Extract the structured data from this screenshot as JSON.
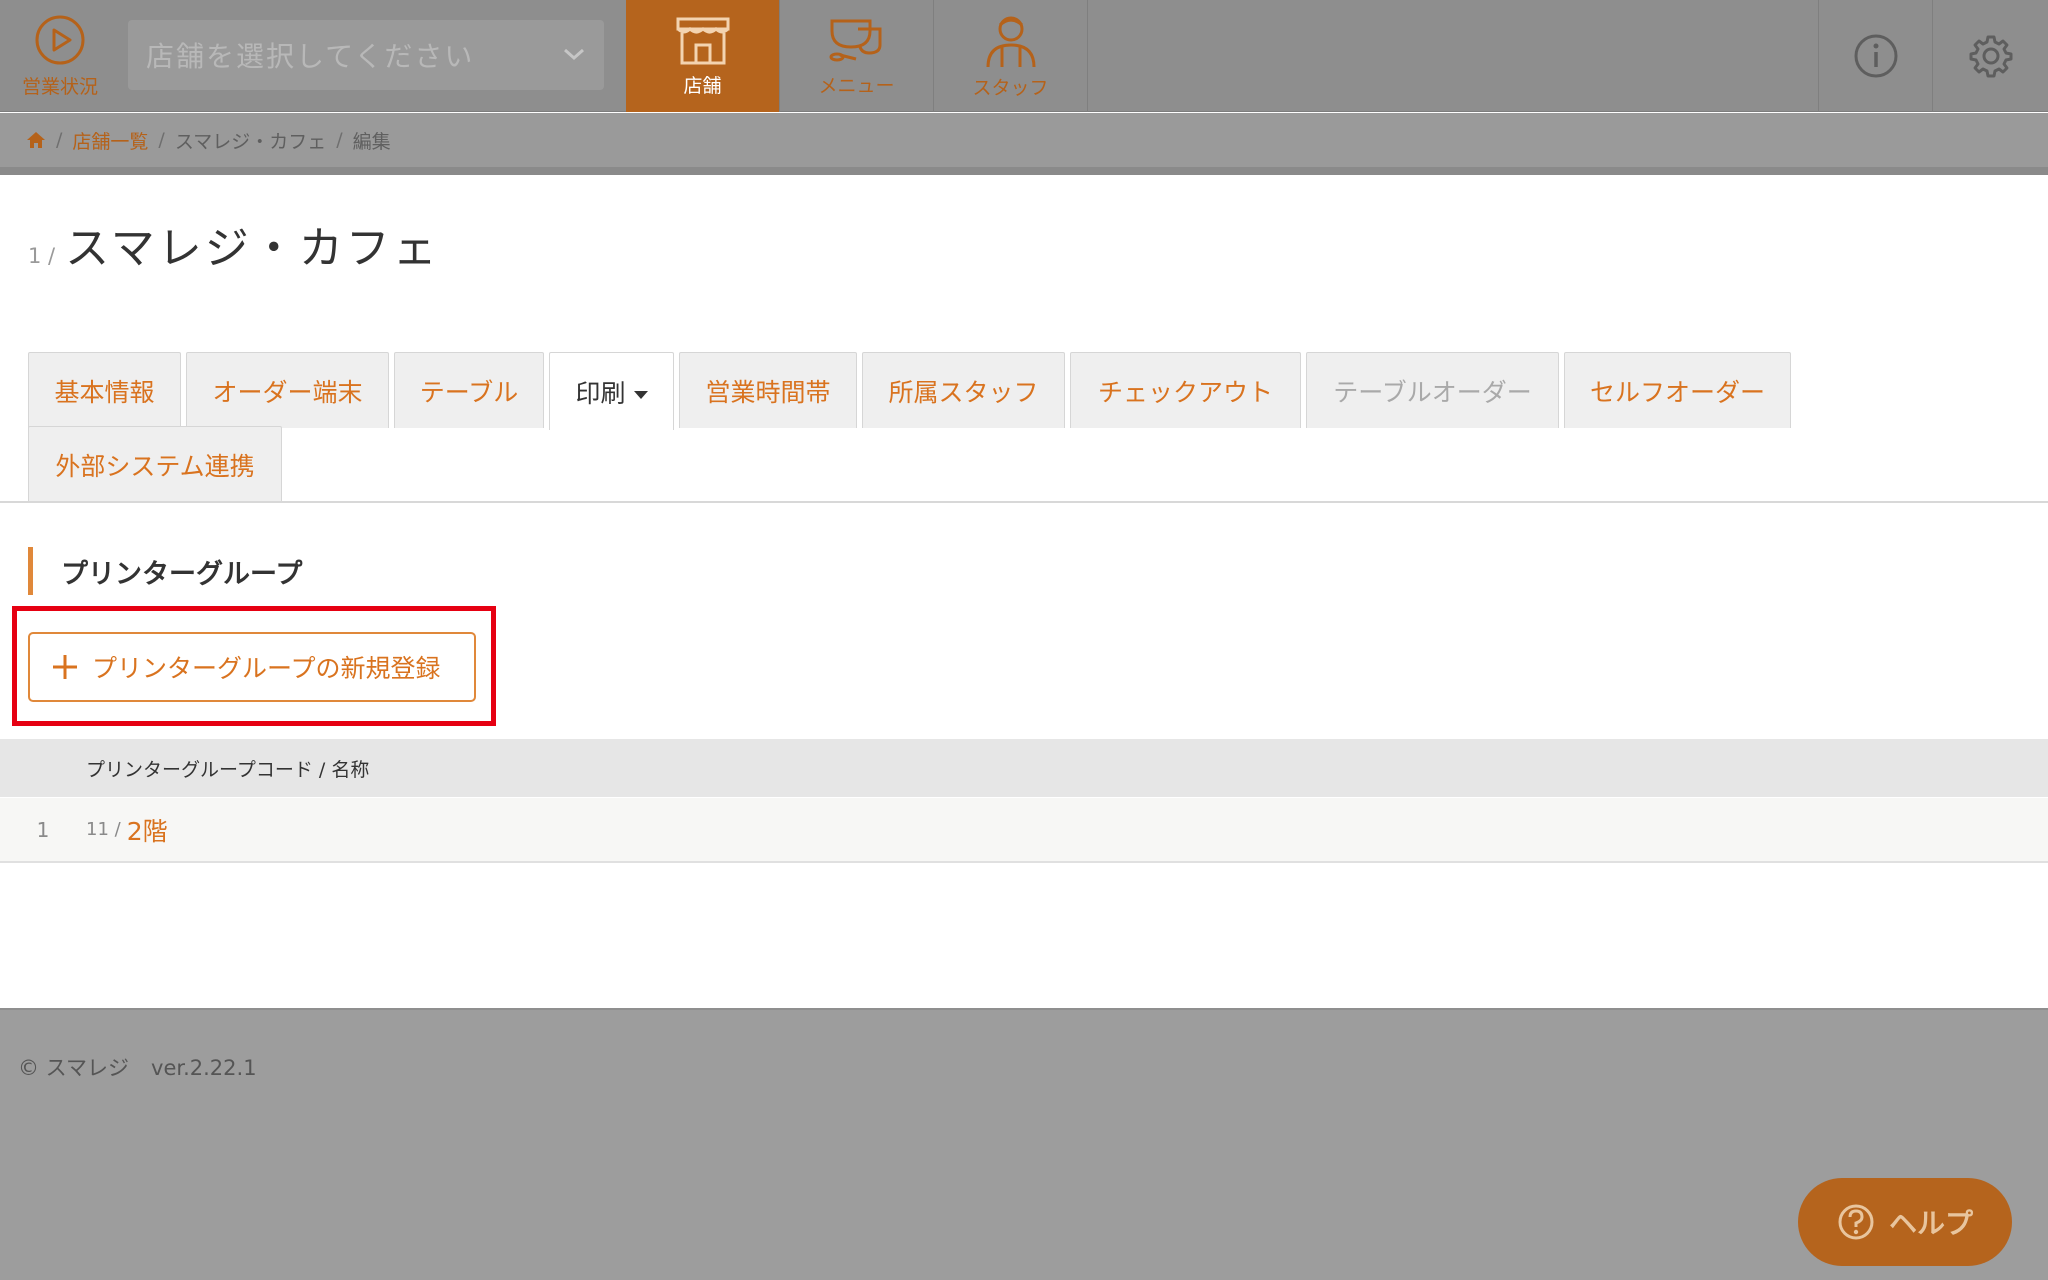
{
  "header": {
    "status_label": "営業状況",
    "store_select_placeholder": "店舗を選択してください",
    "nav": [
      {
        "label": "店舗",
        "active": true
      },
      {
        "label": "メニュー",
        "active": false
      },
      {
        "label": "スタッフ",
        "active": false
      }
    ],
    "info_icon": "info-icon",
    "settings_icon": "gear-icon"
  },
  "breadcrumb": {
    "home_icon": "home-icon",
    "items": [
      "店舗一覧",
      "スマレジ・カフェ",
      "編集"
    ]
  },
  "page": {
    "index": "1 /",
    "title": "スマレジ・カフェ"
  },
  "tabs": [
    {
      "label": "基本情報",
      "state": "normal"
    },
    {
      "label": "オーダー端末",
      "state": "normal"
    },
    {
      "label": "テーブル",
      "state": "normal"
    },
    {
      "label": "印刷",
      "state": "active"
    },
    {
      "label": "営業時間帯",
      "state": "normal"
    },
    {
      "label": "所属スタッフ",
      "state": "normal"
    },
    {
      "label": "チェックアウト",
      "state": "normal"
    },
    {
      "label": "テーブルオーダー",
      "state": "disabled"
    },
    {
      "label": "セルフオーダー",
      "state": "normal"
    },
    {
      "label": "外部システム連携",
      "state": "normal"
    }
  ],
  "section": {
    "title": "プリンターグループ",
    "add_button": "プリンターグループの新規登録"
  },
  "table": {
    "header": "プリンターグループコード / 名称",
    "rows": [
      {
        "num": "1",
        "code": "11 /",
        "name": "2階"
      }
    ]
  },
  "footer": {
    "copyright": "© スマレジ",
    "version": "ver.2.22.1"
  },
  "help": {
    "label": "ヘルプ"
  },
  "colors": {
    "accent": "#d9731f",
    "nav_active": "#b5641d",
    "highlight": "#e60012"
  }
}
